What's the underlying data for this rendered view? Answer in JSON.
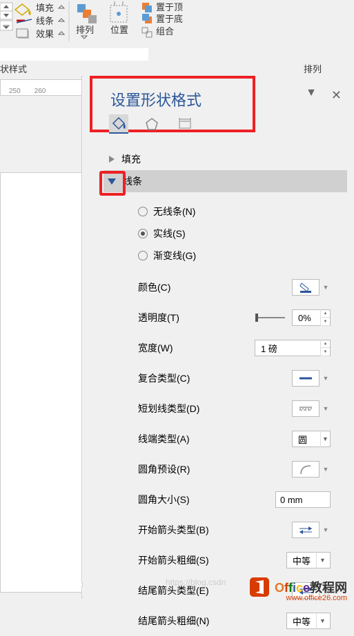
{
  "ribbon": {
    "fill": "填充",
    "line": "线条",
    "effect": "效果",
    "arrange": "排列",
    "position": "位置",
    "bring_front": "置于顶",
    "send_back": "置于底",
    "group": "组合"
  },
  "style_section_label": "状样式",
  "arrange_section_label": "排列",
  "ruler": {
    "t1": "250",
    "t2": "260"
  },
  "panel": {
    "title": "设置形状格式",
    "sections": {
      "fill": "填充",
      "line": "线条"
    },
    "radios": {
      "none": "无线条(N)",
      "solid": "实线(S)",
      "gradient": "渐变线(G)"
    },
    "props": {
      "color": "颜色(C)",
      "transparency": "透明度(T)",
      "transparency_val": "0%",
      "width": "宽度(W)",
      "width_val": "1 磅",
      "compound": "复合类型(C)",
      "dash": "短划线类型(D)",
      "cap": "线端类型(A)",
      "cap_val": "圆",
      "join": "圆角预设(R)",
      "round_size": "圆角大小(S)",
      "round_size_val": "0 mm",
      "begin_arrow_type": "开始箭头类型(B)",
      "begin_arrow_size": "开始箭头粗细(S)",
      "begin_arrow_size_val": "中等",
      "end_arrow_type": "结尾箭头类型(E)",
      "end_arrow_size": "结尾箭头粗细(N)",
      "end_arrow_size_val": "中等"
    }
  },
  "watermark": {
    "brand": "Office",
    "cn": "教程网",
    "url": "www.office26.com",
    "csdn": "https://blog.csdn"
  }
}
